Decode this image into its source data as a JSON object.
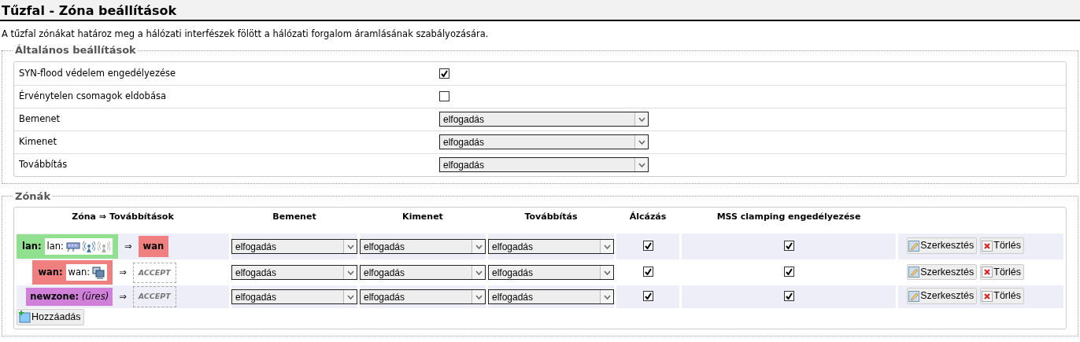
{
  "title": "Tűzfal - Zóna beállítások",
  "description": "A tűzfal zónákat határoz meg a hálózati interfészek fölött a hálózati forgalom áramlásának szabályozására.",
  "general": {
    "legend": "Általános beállítások",
    "rows": [
      {
        "kind": "checkbox",
        "label": "SYN-flood védelem engedélyezése",
        "checked": true
      },
      {
        "kind": "checkbox",
        "label": "Érvénytelen csomagok eldobása",
        "checked": false
      },
      {
        "kind": "select",
        "label": "Bemenet",
        "value": "elfogadás"
      },
      {
        "kind": "select",
        "label": "Kimenet",
        "value": "elfogadás"
      },
      {
        "kind": "select",
        "label": "Továbbítás",
        "value": "elfogadás"
      }
    ]
  },
  "zones": {
    "legend": "Zónák",
    "columns": [
      "Zóna ⇒ Továbbítások",
      "Bemenet",
      "Kimenet",
      "Továbbítás",
      "Álcázás",
      "MSS clamping engedélyezése"
    ],
    "rows": [
      {
        "zone": {
          "name": "lan:",
          "color": "#90e090",
          "interface": "lan:",
          "devices": [
            {
              "kind": "switch",
              "enabled": true
            },
            {
              "kind": "wireless",
              "enabled": true
            },
            {
              "kind": "wireless",
              "enabled": false
            }
          ]
        },
        "arrow": "⇒",
        "forward": {
          "kind": "zone",
          "label": "wan",
          "color": "#f08080"
        },
        "input": "elfogadás",
        "output": "elfogadás",
        "forwarding": "elfogadás",
        "masq": true,
        "mss": true,
        "edit": "Szerkesztés",
        "delete": "Törlés"
      },
      {
        "zone": {
          "name": "wan:",
          "color": "#f08080",
          "interface": "wan:",
          "devices": [
            {
              "kind": "ethernet",
              "enabled": true
            }
          ]
        },
        "arrow": "⇒",
        "forward": {
          "kind": "accept",
          "label": "ACCEPT"
        },
        "input": "elfogadás",
        "output": "elfogadás",
        "forwarding": "elfogadás",
        "masq": true,
        "mss": true,
        "edit": "Szerkesztés",
        "delete": "Törlés"
      },
      {
        "zone": {
          "name": "newzone:",
          "color": "#d080d8",
          "empty": "(üres)"
        },
        "arrow": "⇒",
        "forward": {
          "kind": "accept",
          "label": "ACCEPT"
        },
        "input": "elfogadás",
        "output": "elfogadás",
        "forwarding": "elfogadás",
        "masq": true,
        "mss": true,
        "edit": "Szerkesztés",
        "delete": "Törlés"
      }
    ],
    "add": "Hozzáadás"
  }
}
